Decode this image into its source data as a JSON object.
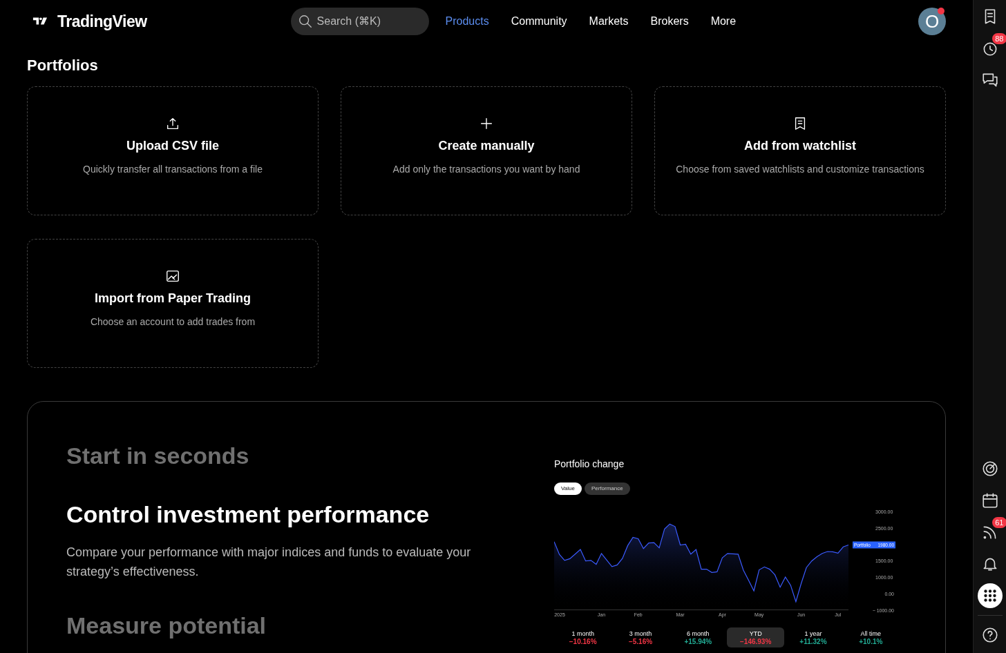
{
  "header": {
    "logo": "TradingView",
    "search": {
      "placeholder": "Search (⌘K)"
    },
    "nav": [
      {
        "label": "Products",
        "selected": true
      },
      {
        "label": "Community",
        "selected": false
      },
      {
        "label": "Markets",
        "selected": false
      },
      {
        "label": "Brokers",
        "selected": false
      },
      {
        "label": "More",
        "selected": false
      }
    ],
    "avatar": {
      "letter": "O",
      "notification": true
    }
  },
  "page_title": "Portfolios",
  "options": [
    {
      "kind": "upload",
      "title": "Upload CSV file",
      "text": "Quickly transfer all transactions from a file"
    },
    {
      "kind": "create",
      "title": "Create manually",
      "text": "Add only the transactions you want by hand"
    },
    {
      "kind": "watchlist",
      "title": "Add from watchlist",
      "text": "Choose from saved watchlists and customize transactions"
    },
    {
      "kind": "paper",
      "title": "Import from Paper Trading",
      "text": "Choose an account to add trades from"
    }
  ],
  "features": [
    {
      "title": "Start in seconds",
      "selected": false
    },
    {
      "title": "Control investment performance",
      "selected": true,
      "text": "Compare your performance with major indices and funds to evaluate your strategy’s effectiveness."
    },
    {
      "title": "Measure potential",
      "selected": false
    }
  ],
  "preview": {
    "title": "Portfolio change",
    "toggles": [
      {
        "label": "Value",
        "selected": true
      },
      {
        "label": "Performance",
        "selected": false
      }
    ],
    "axis_extra_labels": [
      "0.00",
      "− 1000.00"
    ],
    "chart_data": {
      "type": "area",
      "ylim": [
        0,
        3000
      ],
      "yticks": [
        {
          "value": 3000,
          "label": "3000.00"
        },
        {
          "value": 2500,
          "label": "2500.00"
        },
        {
          "value": 1500,
          "label": "1500.00"
        },
        {
          "value": 1000,
          "label": "1000.00"
        }
      ],
      "categories": [
        null,
        "2025",
        null,
        null,
        null,
        null,
        null,
        null,
        null,
        "Jan",
        null,
        null,
        null,
        null,
        null,
        null,
        "Feb",
        null,
        null,
        null,
        null,
        null,
        null,
        null,
        "Mar",
        null,
        null,
        null,
        null,
        null,
        null,
        null,
        "Apr",
        null,
        null,
        null,
        null,
        null,
        null,
        "May",
        null,
        null,
        null,
        null,
        null,
        null,
        null,
        "Jun",
        null,
        null,
        null,
        null,
        null,
        null,
        "Jul",
        null,
        null
      ],
      "series": [
        {
          "name": "Portfolio",
          "color": "#3b5bff",
          "values": [
            2080,
            1690,
            1510,
            1560,
            1700,
            1840,
            1490,
            1510,
            1390,
            1720,
            1520,
            1320,
            1370,
            1570,
            1960,
            2210,
            2170,
            1870,
            2040,
            2050,
            1890,
            2470,
            2620,
            2540,
            1980,
            2000,
            1700,
            1840,
            1240,
            1240,
            1140,
            1160,
            1590,
            1720,
            1710,
            1700,
            1210,
            900,
            580,
            1220,
            1310,
            1240,
            1070,
            690,
            1000,
            750,
            250,
            800,
            1290,
            1490,
            1620,
            1720,
            1780,
            1770,
            1730,
            1920,
            1980
          ]
        }
      ],
      "annotations": [
        "1980.00"
      ]
    },
    "periods": [
      {
        "label": "1 month",
        "change": "−10.16%",
        "color": "#f23645",
        "selected": false
      },
      {
        "label": "3 month",
        "change": "−5.16%",
        "color": "#f23645",
        "selected": false
      },
      {
        "label": "6 month",
        "change": "+15.94%",
        "color": "#22ab94",
        "selected": false
      },
      {
        "label": "YTD",
        "change": "−146.93%",
        "color": "#f23645",
        "selected": true
      },
      {
        "label": "1 year",
        "change": "+11.32%",
        "color": "#22ab94",
        "selected": false
      },
      {
        "label": "All time",
        "change": "+10.1%",
        "color": "#22ab94",
        "selected": false
      }
    ]
  },
  "sidebar": {
    "top": [
      {
        "kind": "watchlist"
      },
      {
        "kind": "alerts",
        "badge": "88"
      },
      {
        "kind": "chats"
      }
    ],
    "bottom": [
      {
        "kind": "screener"
      },
      {
        "kind": "calendar"
      },
      {
        "kind": "news",
        "badge": "61"
      },
      {
        "kind": "notifications"
      },
      {
        "kind": "apps",
        "selected": true
      },
      {
        "kind": "help"
      }
    ]
  }
}
